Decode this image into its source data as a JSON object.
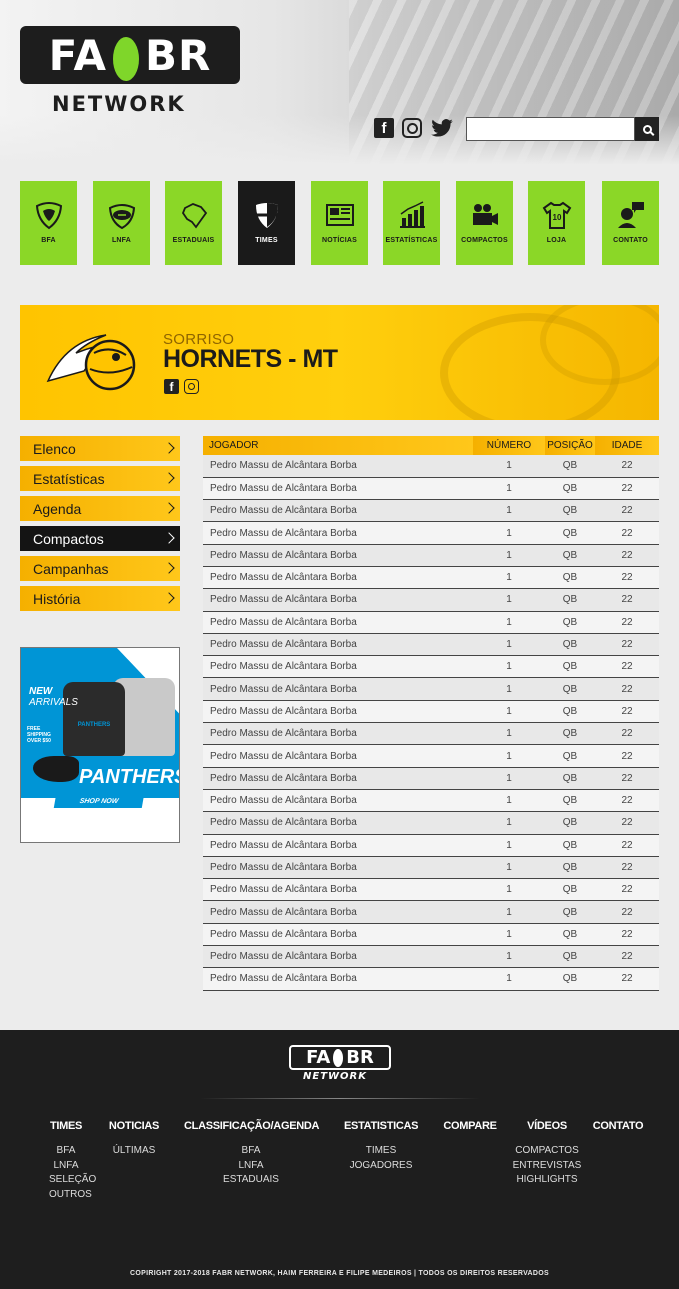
{
  "header": {
    "logo_top": [
      "FA",
      "BR"
    ],
    "logo_bottom": "NETWORK",
    "search": {
      "placeholder": ""
    }
  },
  "nav": [
    {
      "label": "BFA",
      "icon": "bfa-shield-icon"
    },
    {
      "label": "LNFA",
      "icon": "football-icon"
    },
    {
      "label": "ESTADUAIS",
      "icon": "brazil-map-icon"
    },
    {
      "label": "TIMES",
      "icon": "team-shield-icon",
      "active": true
    },
    {
      "label": "NOTÍCIAS",
      "icon": "newspaper-icon"
    },
    {
      "label": "ESTATÍSTICAS",
      "icon": "bar-chart-icon"
    },
    {
      "label": "COMPACTOS",
      "icon": "video-camera-icon"
    },
    {
      "label": "LOJA",
      "icon": "jersey-icon"
    },
    {
      "label": "CONTATO",
      "icon": "contact-icon"
    }
  ],
  "team": {
    "city": "SORRISO",
    "name": "HORNETS - MT"
  },
  "sidebar": {
    "items": [
      {
        "label": "Elenco"
      },
      {
        "label": "Estatísticas"
      },
      {
        "label": "Agenda"
      },
      {
        "label": "Compactos",
        "active": true
      },
      {
        "label": "Campanhas"
      },
      {
        "label": "História"
      }
    ]
  },
  "ad": {
    "headline": "NEW",
    "headline2": "ARRIVALS",
    "free_shipping": "FREE SHIPPING OVER $50",
    "brand": "PANTHERS",
    "cta": "SHOP NOW",
    "shirt_text": "PANTHERS"
  },
  "roster": {
    "columns": [
      "JOGADOR",
      "NÚMERO",
      "POSIÇÃO",
      "IDADE"
    ],
    "rows": [
      [
        "Pedro Massu de Alcântara Borba",
        "1",
        "QB",
        "22"
      ],
      [
        "Pedro Massu de Alcântara Borba",
        "1",
        "QB",
        "22"
      ],
      [
        "Pedro Massu de Alcântara Borba",
        "1",
        "QB",
        "22"
      ],
      [
        "Pedro Massu de Alcântara Borba",
        "1",
        "QB",
        "22"
      ],
      [
        "Pedro Massu de Alcântara Borba",
        "1",
        "QB",
        "22"
      ],
      [
        "Pedro Massu de Alcântara Borba",
        "1",
        "QB",
        "22"
      ],
      [
        "Pedro Massu de Alcântara Borba",
        "1",
        "QB",
        "22"
      ],
      [
        "Pedro Massu de Alcântara Borba",
        "1",
        "QB",
        "22"
      ],
      [
        "Pedro Massu de Alcântara Borba",
        "1",
        "QB",
        "22"
      ],
      [
        "Pedro Massu de Alcântara Borba",
        "1",
        "QB",
        "22"
      ],
      [
        "Pedro Massu de Alcântara Borba",
        "1",
        "QB",
        "22"
      ],
      [
        "Pedro Massu de Alcântara Borba",
        "1",
        "QB",
        "22"
      ],
      [
        "Pedro Massu de Alcântara Borba",
        "1",
        "QB",
        "22"
      ],
      [
        "Pedro Massu de Alcântara Borba",
        "1",
        "QB",
        "22"
      ],
      [
        "Pedro Massu de Alcântara Borba",
        "1",
        "QB",
        "22"
      ],
      [
        "Pedro Massu de Alcântara Borba",
        "1",
        "QB",
        "22"
      ],
      [
        "Pedro Massu de Alcântara Borba",
        "1",
        "QB",
        "22"
      ],
      [
        "Pedro Massu de Alcântara Borba",
        "1",
        "QB",
        "22"
      ],
      [
        "Pedro Massu de Alcântara Borba",
        "1",
        "QB",
        "22"
      ],
      [
        "Pedro Massu de Alcântara Borba",
        "1",
        "QB",
        "22"
      ],
      [
        "Pedro Massu de Alcântara Borba",
        "1",
        "QB",
        "22"
      ],
      [
        "Pedro Massu de Alcântara Borba",
        "1",
        "QB",
        "22"
      ],
      [
        "Pedro Massu de Alcântara Borba",
        "1",
        "QB",
        "22"
      ],
      [
        "Pedro Massu de Alcântara Borba",
        "1",
        "QB",
        "22"
      ]
    ]
  },
  "footer": {
    "logo_top": [
      "FA",
      "BR"
    ],
    "logo_bottom": "NETWORK",
    "columns": [
      {
        "heading": "TIMES",
        "links": [
          "BFA",
          "LNFA",
          "SELEÇÃO",
          "OUTROS"
        ]
      },
      {
        "heading": "NOTICIAS",
        "links": [
          "ÚLTIMAS"
        ]
      },
      {
        "heading": "CLASSIFICAÇÃO/AGENDA",
        "links": [
          "BFA",
          "LNFA",
          "ESTADUAIS"
        ]
      },
      {
        "heading": "ESTATISTICAS",
        "links": [
          "TIMES",
          "JOGADORES"
        ]
      },
      {
        "heading": "COMPARE",
        "links": []
      },
      {
        "heading": "VÍDEOS",
        "links": [
          "COMPACTOS",
          "ENTREVISTAS",
          "HIGHLIGHTS"
        ]
      },
      {
        "heading": "CONTATO",
        "links": []
      }
    ],
    "copyright": "COPIRIGHT 2017-2018 FABR NETWORK, HAIM FERREIRA E FILIPE MEDEIROS | TODOS OS DIREITOS RESERVADOS"
  },
  "colors": {
    "accent_green": "#8bd727",
    "accent_yellow": "#ffc400",
    "dark": "#1a1a1a",
    "footer_bg": "#1e1e1e"
  }
}
